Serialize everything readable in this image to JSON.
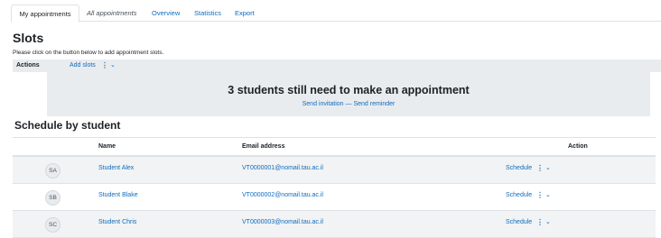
{
  "tabs": [
    {
      "label": "My appointments"
    },
    {
      "label": "All appointments"
    },
    {
      "label": "Overview"
    },
    {
      "label": "Statistics"
    },
    {
      "label": "Export"
    }
  ],
  "page_title": "Slots",
  "hint": "Please click on the button below to add appointment slots.",
  "actions": {
    "label": "Actions",
    "add_slots": "Add slots"
  },
  "banner": {
    "title": "3 students still need to make an appointment",
    "send_invitation": "Send invitation",
    "separator": "—",
    "send_reminder": "Send reminder"
  },
  "schedule": {
    "title": "Schedule by student",
    "headers": {
      "name": "Name",
      "email": "Email address",
      "action": "Action"
    },
    "rows": [
      {
        "initials": "SA",
        "name": "Student Alex",
        "email": "VT0000001@nomail.tau.ac.il",
        "action": "Schedule"
      },
      {
        "initials": "SB",
        "name": "Student Blake",
        "email": "VT0000002@nomail.tau.ac.il",
        "action": "Schedule"
      },
      {
        "initials": "SC",
        "name": "Student Chris",
        "email": "VT0000003@nomail.tau.ac.il",
        "action": "Schedule"
      }
    ]
  },
  "colors": {
    "link": "#0f6cbf",
    "banner_bg": "#e9ecef",
    "row_stripe": "#f1f3f4"
  }
}
